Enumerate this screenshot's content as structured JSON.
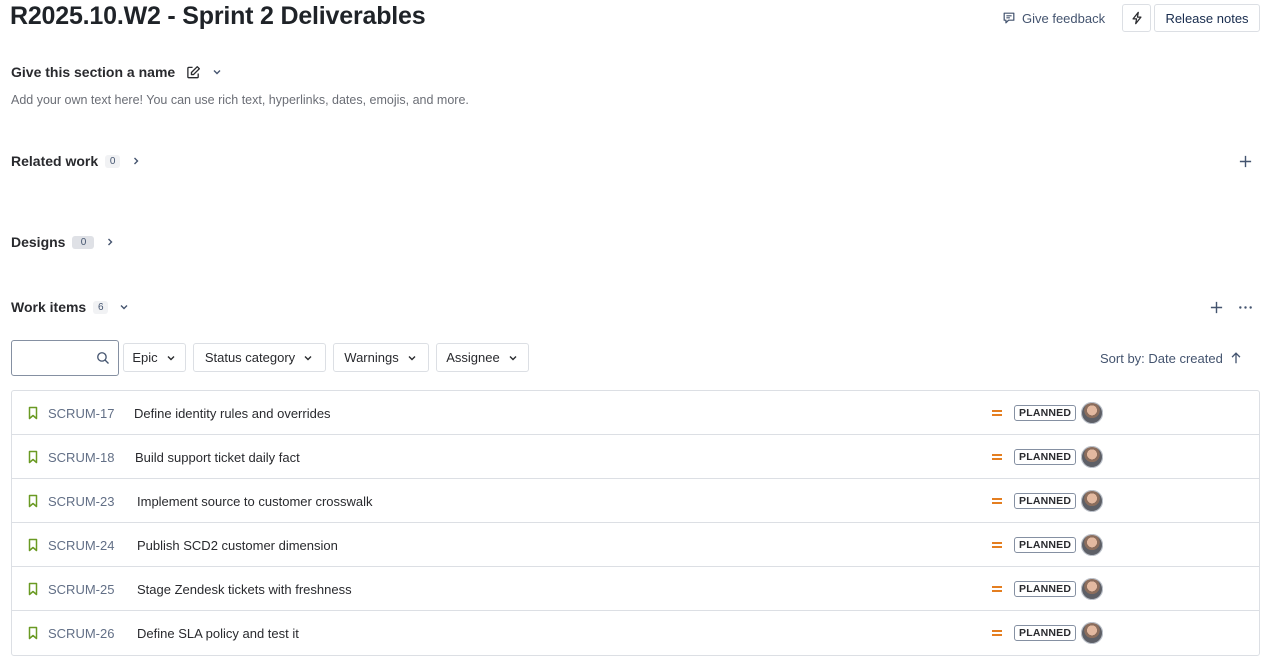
{
  "header": {
    "title": "R2025.10.W2 - Sprint 2 Deliverables",
    "feedback_label": "Give feedback",
    "release_notes_label": "Release notes"
  },
  "section": {
    "name": "Give this section a name",
    "description": "Add your own text here! You can use rich text, hyperlinks, dates, emojis, and more."
  },
  "related_work": {
    "label": "Related work",
    "count": "0"
  },
  "designs": {
    "label": "Designs",
    "count": "0"
  },
  "work_items": {
    "label": "Work items",
    "count": "6",
    "search_value": "",
    "filters": {
      "epic": "Epic",
      "status_category": "Status category",
      "warnings": "Warnings",
      "assignee": "Assignee"
    },
    "sort_label": "Sort by: Date created",
    "items": [
      {
        "key": "SCRUM-17",
        "summary": "Define identity rules and overrides",
        "status": "PLANNED"
      },
      {
        "key": "SCRUM-18",
        "summary": "Build support ticket daily fact",
        "status": "PLANNED"
      },
      {
        "key": "SCRUM-23",
        "summary": "Implement source to customer crosswalk",
        "status": "PLANNED"
      },
      {
        "key": "SCRUM-24",
        "summary": "Publish SCD2 customer dimension",
        "status": "PLANNED"
      },
      {
        "key": "SCRUM-25",
        "summary": "Stage Zendesk tickets with freshness",
        "status": "PLANNED"
      },
      {
        "key": "SCRUM-26",
        "summary": "Define SLA policy and test it",
        "status": "PLANNED"
      }
    ]
  },
  "icons": {
    "feedback": "feedback-icon",
    "bolt": "lightning-icon",
    "edit": "edit-icon",
    "type": "story-bookmark-icon",
    "priority": "medium-priority-icon",
    "search": "search-icon",
    "sort": "arrow-up-icon"
  },
  "colors": {
    "story_icon": "#6a9a23",
    "priority_medium": "#e06c00",
    "border": "#dcdfe4"
  }
}
